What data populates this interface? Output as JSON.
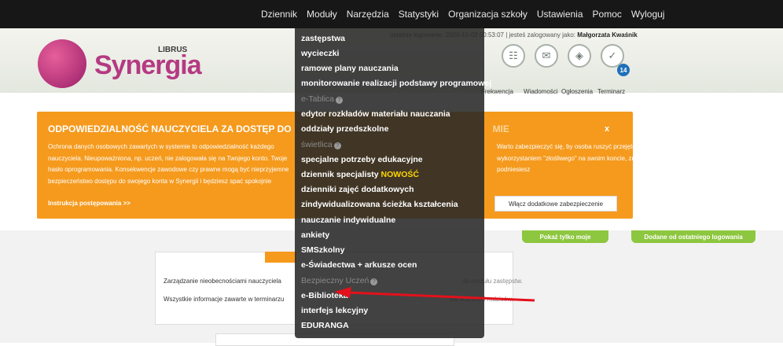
{
  "topnav": {
    "items": [
      "Dziennik",
      "Moduły",
      "Narzędzia",
      "Statystyki",
      "Organizacja szkoły",
      "Ustawienia",
      "Pomoc",
      "Wyloguj"
    ]
  },
  "header": {
    "logo_text": "Synergia",
    "logo_sub": "LIBRUS",
    "last_login_prefix": "ostatnie logowanie: 2020-10-02 00:53:07 | jesteś zalogowany jako:",
    "user": "Małgorzata Kwaśnik",
    "icons": [
      {
        "label": "Frekwencja",
        "icon": "calendar-icon"
      },
      {
        "label": "Wiadomości",
        "icon": "envelope-icon"
      },
      {
        "label": "Ogłoszenia",
        "icon": "megaphone-icon"
      },
      {
        "label": "Terminarz",
        "icon": "calendar-check-icon"
      }
    ],
    "badge": "14"
  },
  "alert": {
    "title": "ODPOWIEDZIALNOŚĆ NAUCZYCIELA ZA DOSTĘP DO",
    "title_tail": "MIE",
    "text": "Ochrona danych osobowych zawartych w systemie to odpowiedzialność każdego nauczyciela. Nieupoważniona, np. uczeń, nie zalogowała się na Twojego konto. Twoje hasło oprogramowania. Konsekwencje zawodowe czy prawne mogą być nieprzyjemne bezpieczeństwo dostępu do swojego konta w Synergii i będziesz spać spokojnie",
    "text_right": "Warto zabezpieczyć się, by osoba ruszyć przejęte z wykorzystaniem \"złośliwego\" na swoim koncie, znacząco podniesiesz",
    "link": "Instrukcja postępowania >>",
    "close": "x",
    "button": "Włącz dodatkowe zabezpieczenie"
  },
  "tabs": {
    "mine": "Pokaż tylko moje",
    "recent": "Dodane od ostatniego logowania"
  },
  "card": {
    "line1": "Zarządzanie nieobecnościami nauczyciela",
    "line1_tail": "do modułu zastępstw.",
    "line2": "Wszystkie informacje zawarte w terminarzu",
    "line2_tail": "dla uczniów i rodziców."
  },
  "menu": {
    "items": [
      {
        "label": "zastępstwa",
        "dim": false
      },
      {
        "label": "wycieczki",
        "dim": false
      },
      {
        "label": "ramowe plany nauczania",
        "dim": false
      },
      {
        "label": "monitorowanie realizacji podstawy programowej",
        "dim": false
      },
      {
        "label": "e-Tablica",
        "dim": true,
        "help": true
      },
      {
        "label": "edytor rozkładów materiału nauczania",
        "dim": false
      },
      {
        "label": "oddziały przedszkolne",
        "dim": false
      },
      {
        "label": "świetlica",
        "dim": true,
        "help": true
      },
      {
        "label": "specjalne potrzeby edukacyjne",
        "dim": false
      },
      {
        "label": "dziennik specjalisty",
        "dim": false,
        "new": "NOWOŚĆ"
      },
      {
        "label": "dzienniki zajęć dodatkowych",
        "dim": false
      },
      {
        "label": "zindywidualizowana ścieżka kształcenia",
        "dim": false
      },
      {
        "label": "nauczanie indywidualne",
        "dim": false
      },
      {
        "label": "ankiety",
        "dim": false
      },
      {
        "label": "SMSzkolny",
        "dim": false
      },
      {
        "label": "e-Świadectwa + arkusze ocen",
        "dim": false
      },
      {
        "label": "Bezpieczny Uczeń",
        "dim": true,
        "help": true
      },
      {
        "label": "e-Biblioteka",
        "dim": false
      },
      {
        "label": "interfejs lekcyjny",
        "dim": false
      },
      {
        "label": "EDURANGA",
        "dim": false
      }
    ]
  },
  "colors": {
    "topbar": "#171717",
    "accent_orange": "#f59a1d",
    "accent_green": "#8dc63f",
    "brand": "#b43a82",
    "arrow": "#e3111b"
  }
}
